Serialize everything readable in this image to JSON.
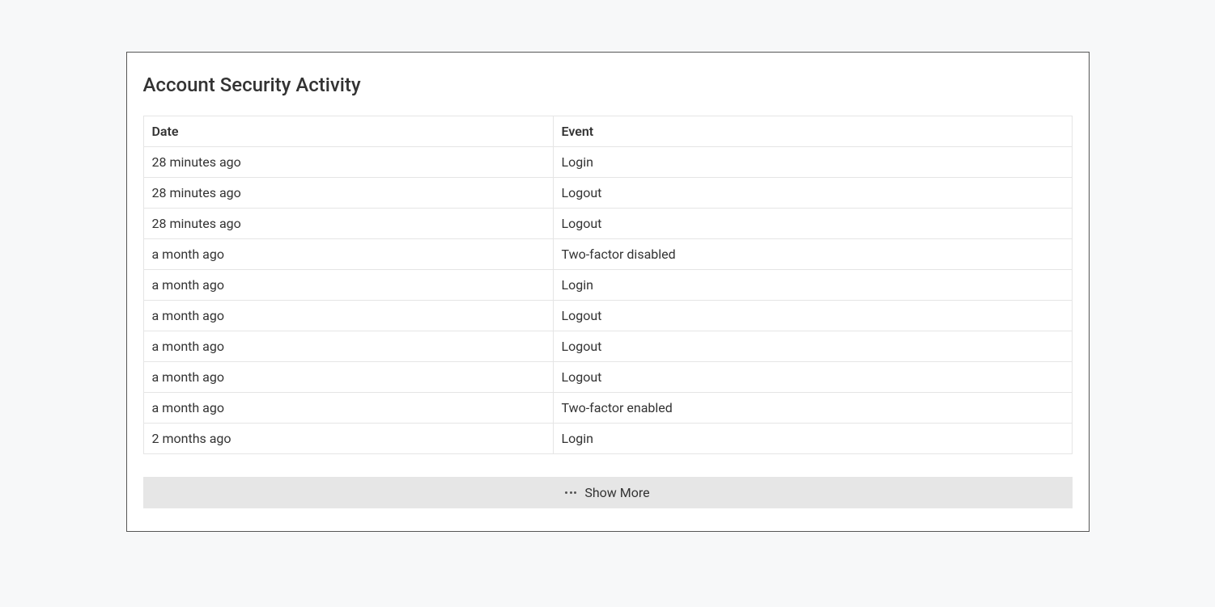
{
  "card": {
    "title": "Account Security Activity"
  },
  "table": {
    "headers": {
      "date": "Date",
      "event": "Event"
    },
    "rows": [
      {
        "date": "28 minutes ago",
        "event": "Login"
      },
      {
        "date": "28 minutes ago",
        "event": "Logout"
      },
      {
        "date": "28 minutes ago",
        "event": "Logout"
      },
      {
        "date": "a month ago",
        "event": "Two-factor disabled"
      },
      {
        "date": "a month ago",
        "event": "Login"
      },
      {
        "date": "a month ago",
        "event": "Logout"
      },
      {
        "date": "a month ago",
        "event": "Logout"
      },
      {
        "date": "a month ago",
        "event": "Logout"
      },
      {
        "date": "a month ago",
        "event": "Two-factor enabled"
      },
      {
        "date": "2 months ago",
        "event": "Login"
      }
    ]
  },
  "actions": {
    "show_more_label": "Show More"
  }
}
